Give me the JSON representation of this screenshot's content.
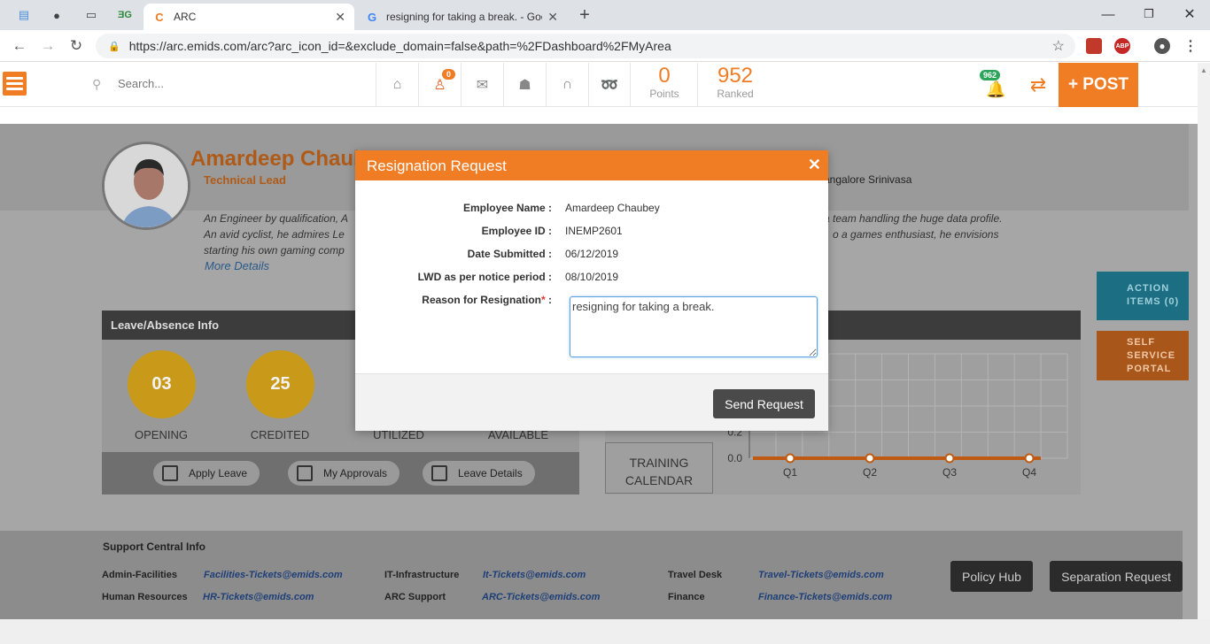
{
  "browser": {
    "tabs": [
      {
        "title": "ARC",
        "active": true
      },
      {
        "title": "resigning for taking a break. - Goo",
        "active": false
      }
    ],
    "new_tab": "+",
    "url": "https://arc.emids.com/arc?arc_icon_id=&exclude_domain=false&path=%2FDashboard%2FMyArea",
    "ext_abp": "ABP"
  },
  "header": {
    "search_placeholder": "Search...",
    "notif_count": "0",
    "points_value": "0",
    "points_label": "Points",
    "ranked_value": "952",
    "ranked_label": "Ranked",
    "bell_count": "962",
    "post_label": "+ POST"
  },
  "profile": {
    "name": "Amardeep Chaubey",
    "title": "Technical Lead",
    "manager": "angalore Srinivasa",
    "bio_line1": "An Engineer by qualification, A",
    "bio_line1_right": "a team handling the huge data profile.",
    "bio_line2": "An avid cyclist, he admires Le",
    "bio_line2_right": "o a games enthusiast, he envisions",
    "bio_line3": "starting his own gaming comp",
    "more_details": "More Details"
  },
  "leave": {
    "header": "Leave/Absence Info",
    "opening_value": "03",
    "opening_label": "OPENING",
    "credited_value": "25",
    "credited_label": "CREDITED",
    "utilized_label": "UTILIZED",
    "available_label": "AVAILABLE",
    "apply_leave": "Apply Leave",
    "my_approvals": "My Approvals",
    "leave_details": "Leave Details"
  },
  "training": {
    "line1": "TRAINING",
    "line2": "CALENDAR"
  },
  "chart_data": {
    "type": "line",
    "categories": [
      "Q1",
      "Q2",
      "Q3",
      "Q4"
    ],
    "values": [
      0,
      0,
      0,
      0
    ],
    "y_ticks": [
      "0.2",
      "0.0"
    ],
    "color": "#c05a12"
  },
  "side_tabs": {
    "action_items": [
      "ACTION",
      "ITEMS (0)"
    ],
    "self_service": [
      "SELF",
      "SERVICE",
      "PORTAL"
    ]
  },
  "support": {
    "header": "Support Central Info",
    "admin_label": "Admin-Facilities",
    "admin_link": "Facilities-Tickets@emids.com",
    "hr_label": "Human Resources",
    "hr_link": "HR-Tickets@emids.com",
    "it_label": "IT-Infrastructure",
    "it_link": "It-Tickets@emids.com",
    "arc_label": "ARC Support",
    "arc_link": "ARC-Tickets@emids.com",
    "travel_label": "Travel Desk",
    "travel_link": "Travel-Tickets@emids.com",
    "finance_label": "Finance",
    "finance_link": "Finance-Tickets@emids.com",
    "policy_hub": "Policy Hub",
    "separation_request": "Separation Request"
  },
  "modal": {
    "title": "Resignation Request",
    "close": "✕",
    "employee_name_label": "Employee Name :",
    "employee_name": "Amardeep Chaubey",
    "employee_id_label": "Employee ID :",
    "employee_id": "INEMP2601",
    "date_submitted_label": "Date Submitted :",
    "date_submitted": "06/12/2019",
    "lwd_label": "LWD as per notice period :",
    "lwd": "08/10/2019",
    "reason_label": "Reason for Resignation",
    "reason_req": "*",
    "reason_colon": " :",
    "reason_value": "resigning for taking a break.",
    "send_button": "Send Request"
  }
}
